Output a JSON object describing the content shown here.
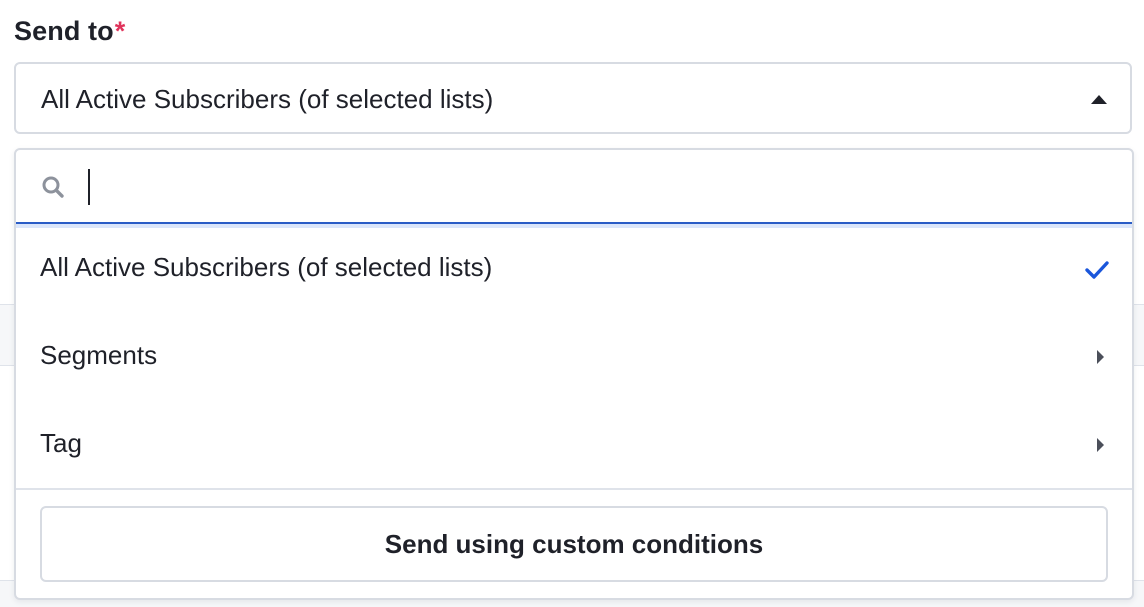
{
  "field": {
    "label": "Send to",
    "required_marker": "*",
    "selected_value": "All Active Subscribers (of selected lists)"
  },
  "dropdown": {
    "search": {
      "placeholder": "",
      "value": "",
      "icon": "search-icon"
    },
    "options": [
      {
        "label": "All Active Subscribers (of selected lists)",
        "selected": true,
        "indicator": "check-icon"
      },
      {
        "label": "Segments",
        "selected": false,
        "indicator": "chevron-right-icon"
      },
      {
        "label": "Tag",
        "selected": false,
        "indicator": "chevron-right-icon"
      }
    ],
    "footer_button_label": "Send using custom conditions"
  },
  "colors": {
    "accent": "#2a5cc6",
    "check": "#1a56db",
    "required": "#e0335b",
    "border": "#d7dbe2",
    "text": "#1f2129"
  }
}
